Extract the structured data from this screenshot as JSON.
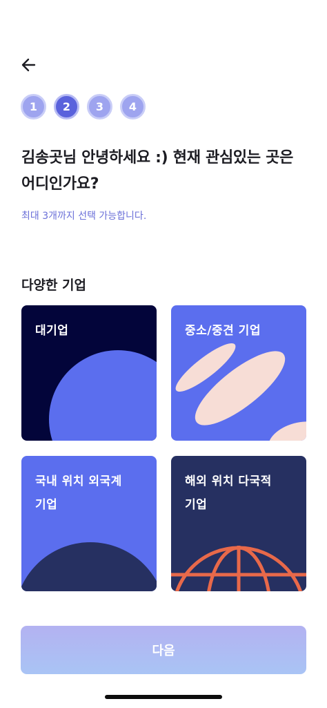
{
  "steps": [
    {
      "label": "1",
      "active": false
    },
    {
      "label": "2",
      "active": true
    },
    {
      "label": "3",
      "active": false
    },
    {
      "label": "4",
      "active": false
    }
  ],
  "question": {
    "title": "김송곳님 안녕하세요 :) 현재 관심있는 곳은 어디인가요?",
    "subtitle": "최대 3개까지 선택 가능합니다."
  },
  "section": {
    "title": "다양한 기업",
    "cards": [
      {
        "label": "대기업"
      },
      {
        "label": "중소/중견 기업"
      },
      {
        "label": "국내 위치 외국계 기업"
      },
      {
        "label": "해외 위치 다국적 기업"
      }
    ]
  },
  "footer": {
    "next_label": "다음"
  },
  "icons": {
    "back": "arrow-left-icon"
  },
  "colors": {
    "accent": "#5a62dc",
    "step_inactive": "#9ea4ef",
    "subtitle": "#6a6fd8",
    "card_navy": "#03053a",
    "card_blue": "#5b6eee",
    "card_indigo": "#263061",
    "globe_orange": "#e8694a",
    "leaf_peach": "#f7ddd6"
  }
}
